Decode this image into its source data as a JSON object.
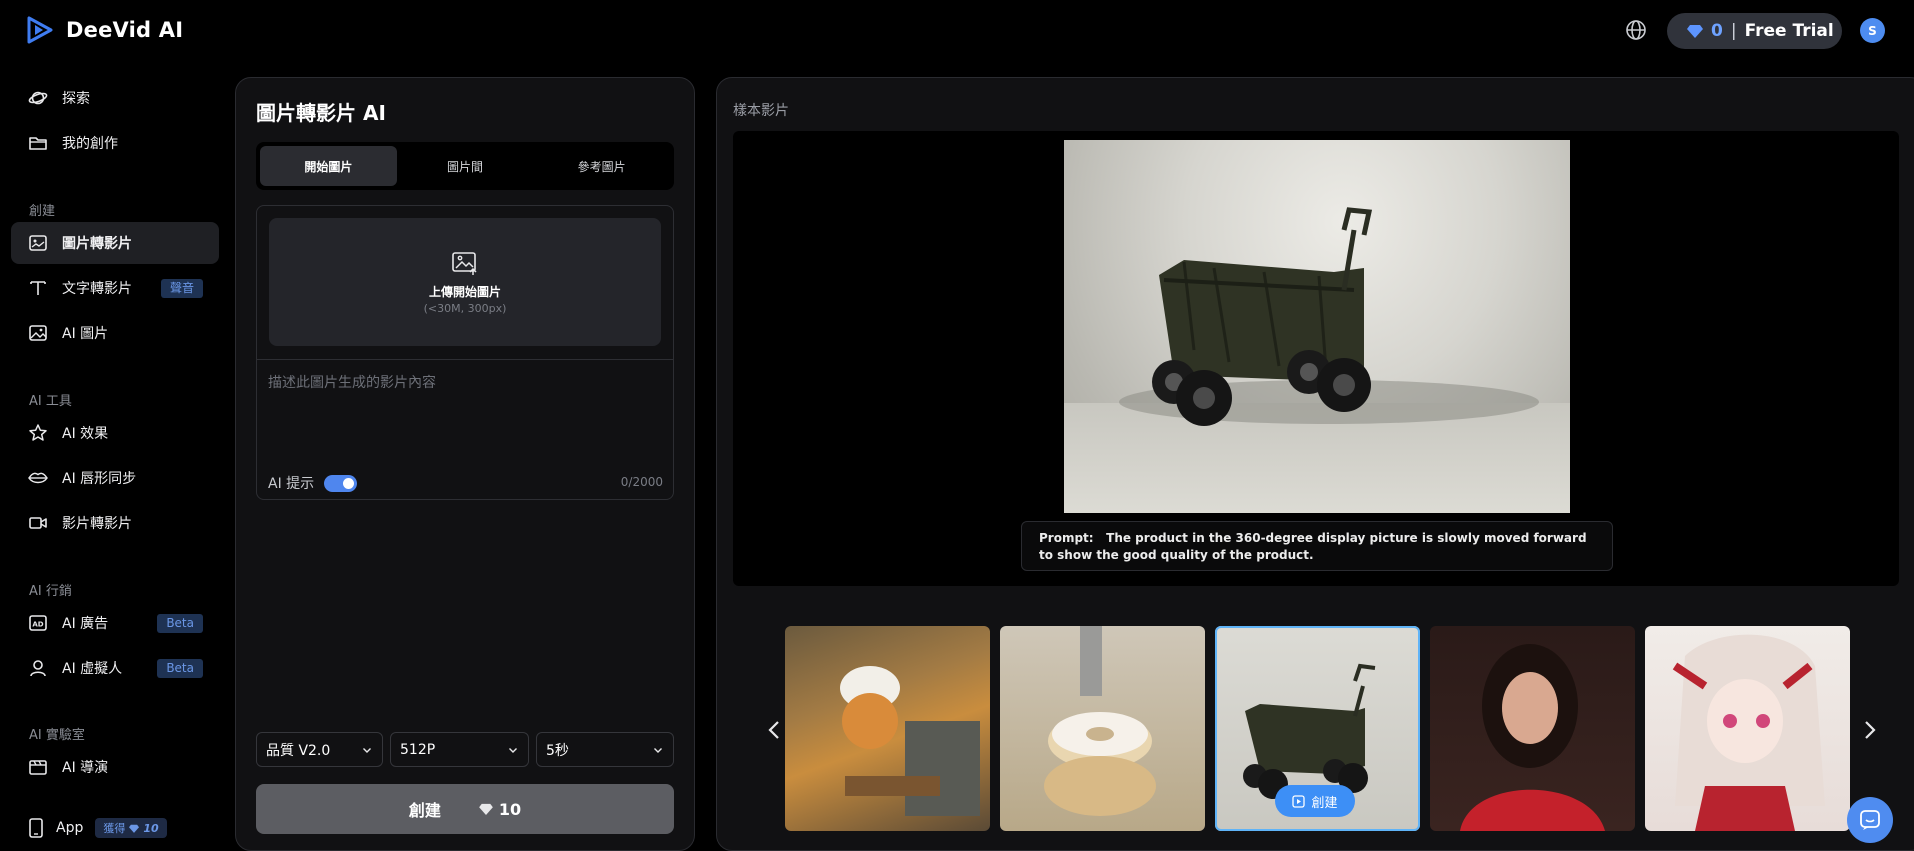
{
  "brand": {
    "name": "DeeVid AI"
  },
  "topbar": {
    "credits": "0",
    "separator": "|",
    "trial_label": "Free Trial",
    "avatar_initial": "S"
  },
  "sidebar": {
    "explore": "探索",
    "my_creations": "我的創作",
    "section_create": "創建",
    "image_to_video": "圖片轉影片",
    "text_to_video": "文字轉影片",
    "text_to_video_badge": "聲音",
    "ai_image": "AI 圖片",
    "section_tools": "AI 工具",
    "ai_effects": "AI 效果",
    "ai_lipsync": "AI 唇形同步",
    "video_to_video": "影片轉影片",
    "section_marketing": "AI 行銷",
    "ai_ads": "AI 廣告",
    "ai_ads_badge": "Beta",
    "ai_avatar": "AI 虛擬人",
    "ai_avatar_badge": "Beta",
    "section_lab": "AI 實驗室",
    "ai_director": "AI 導演",
    "app_label": "App",
    "app_badge_text": "獲得",
    "app_badge_value": "10"
  },
  "form": {
    "title": "圖片轉影片 AI",
    "tabs": [
      {
        "label": "開始圖片",
        "active": true
      },
      {
        "label": "圖片間",
        "active": false
      },
      {
        "label": "參考圖片",
        "active": false
      }
    ],
    "upload_label": "上傳開始圖片",
    "upload_hint": "(<30M, 300px)",
    "prompt_placeholder": "描述此圖片生成的影片內容",
    "ai_prompt_label": "AI 提示",
    "ai_prompt_enabled": true,
    "char_count": "0/2000",
    "quality": "品質 V2.0",
    "resolution": "512P",
    "duration": "5秒",
    "create_label": "創建",
    "create_cost": "10"
  },
  "sample": {
    "title": "樣本影片",
    "prompt_prefix": "Prompt:",
    "prompt_text": "The product in the 360-degree display picture is slowly moved forward to show the good quality of the product.",
    "thumb_create_label": "創建",
    "thumbnails": [
      "chef-cat-oven",
      "robot-arm-donut",
      "folding-wagon",
      "woman-red-sweater",
      "anime-girl"
    ],
    "selected_index": 2
  },
  "colors": {
    "accent": "#4f86ee",
    "selected_outline": "#5fb3f7",
    "badge_bg": "#1e3253"
  }
}
